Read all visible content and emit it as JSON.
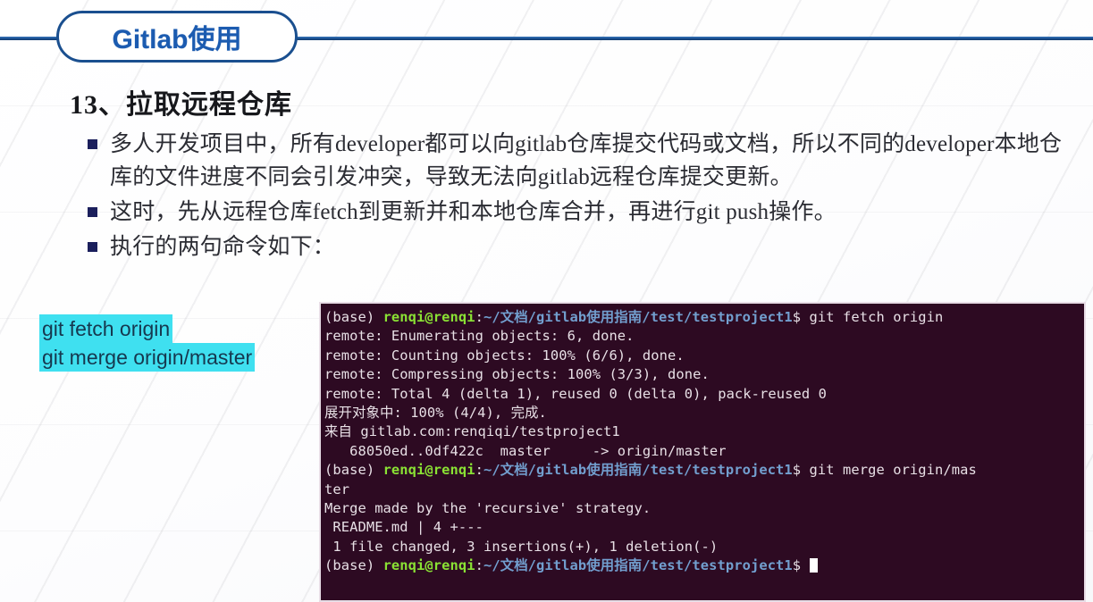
{
  "header": {
    "pill_title": "Gitlab使用"
  },
  "section": {
    "heading": "13、拉取远程仓库"
  },
  "bullets": [
    "多人开发项目中，所有developer都可以向gitlab仓库提交代码或文档，所以不同的developer本地仓库的文件进度不同会引发冲突，导致无法向gitlab远程仓库提交更新。",
    "这时，先从远程仓库fetch到更新并和本地仓库合并，再进行git push操作。",
    "执行的两句命令如下："
  ],
  "commands": [
    "git fetch origin",
    "git merge origin/master"
  ],
  "terminal": {
    "prompt_env": "(base) ",
    "prompt_user": "renqi@renqi",
    "prompt_sep": ":",
    "prompt_path": "~/文档/gitlab使用指南/test/testproject1",
    "prompt_dollar": "$ ",
    "lines": [
      {
        "type": "prompt",
        "command": " git fetch origin"
      },
      {
        "type": "out",
        "text": "remote: Enumerating objects: 6, done."
      },
      {
        "type": "out",
        "text": "remote: Counting objects: 100% (6/6), done."
      },
      {
        "type": "out",
        "text": "remote: Compressing objects: 100% (3/3), done."
      },
      {
        "type": "out",
        "text": "remote: Total 4 (delta 1), reused 0 (delta 0), pack-reused 0"
      },
      {
        "type": "out",
        "text": "展开对象中: 100% (4/4), 完成."
      },
      {
        "type": "out",
        "text": "来自 gitlab.com:renqiqi/testproject1"
      },
      {
        "type": "out",
        "text": "   68050ed..0df422c  master     -> origin/master"
      },
      {
        "type": "prompt",
        "command": " git merge origin/mas"
      },
      {
        "type": "out",
        "text": "ter"
      },
      {
        "type": "out",
        "text": "Merge made by the 'recursive' strategy."
      },
      {
        "type": "out",
        "text": " README.md | 4 +---"
      },
      {
        "type": "out",
        "text": " 1 file changed, 3 insertions(+), 1 deletion(-)"
      },
      {
        "type": "prompt_cursor",
        "command": " "
      }
    ]
  },
  "colors": {
    "accent_blue": "#1a4f8f",
    "title_blue": "#1b5bb0",
    "highlight_cyan": "#3fe0f0",
    "bullet_navy": "#1b1f5c",
    "terminal_bg": "#2d0a22",
    "terminal_user_green": "#8ae234",
    "terminal_path_blue": "#729fcf"
  }
}
